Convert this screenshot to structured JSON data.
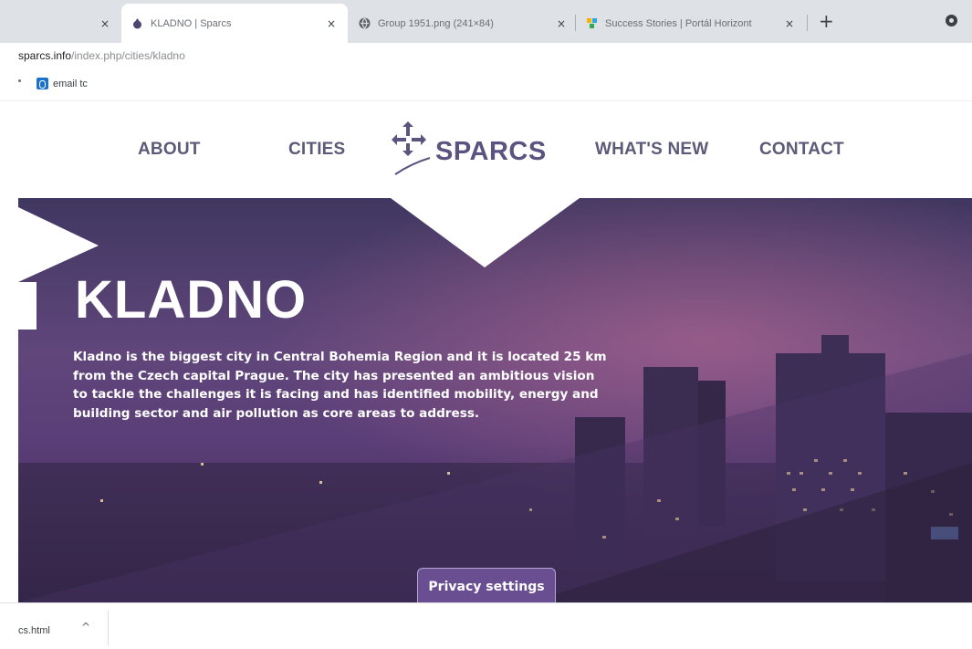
{
  "browser": {
    "tabs": [
      {
        "title": "",
        "close": "×"
      },
      {
        "title": "KLADNO | Sparcs",
        "close": "×"
      },
      {
        "title": "Group 1951.png (241×84)",
        "close": "×"
      },
      {
        "title": "Success Stories | Portál Horizont",
        "close": "×"
      }
    ],
    "new_tab": "+",
    "address": {
      "host": "sparcs.info",
      "path": "/index.php/cities/kladno"
    },
    "bookmarks": {
      "overflow": ":",
      "items": [
        {
          "label": "email tc"
        }
      ]
    }
  },
  "site": {
    "nav": {
      "about": "ABOUT",
      "cities": "CITIES",
      "whats_new": "WHAT'S NEW",
      "contact": "CONTACT"
    },
    "logo_text": "SPARCS"
  },
  "hero": {
    "title": "KLADNO",
    "description": "Kladno is the biggest city in Central Bohemia Region and it is located 25 km from the Czech capital Prague. The city has presented an ambitious vision to tackle the challenges it is facing and has identified mobility, energy and building sector and air pollution as core areas to address."
  },
  "privacy_button": "Privacy settings",
  "download": {
    "filename": "cs.html",
    "chevron": "^"
  },
  "colors": {
    "brand": "#5b5380",
    "nav": "#5c5a78",
    "hero_dark": "#403761",
    "privacy_bg": "#6a4e92"
  },
  "icons": {
    "tab2": "sparcs-favicon",
    "tab3": "globe-icon",
    "tab4": "horizont-favicon",
    "bookmark": "outlook-icon"
  }
}
